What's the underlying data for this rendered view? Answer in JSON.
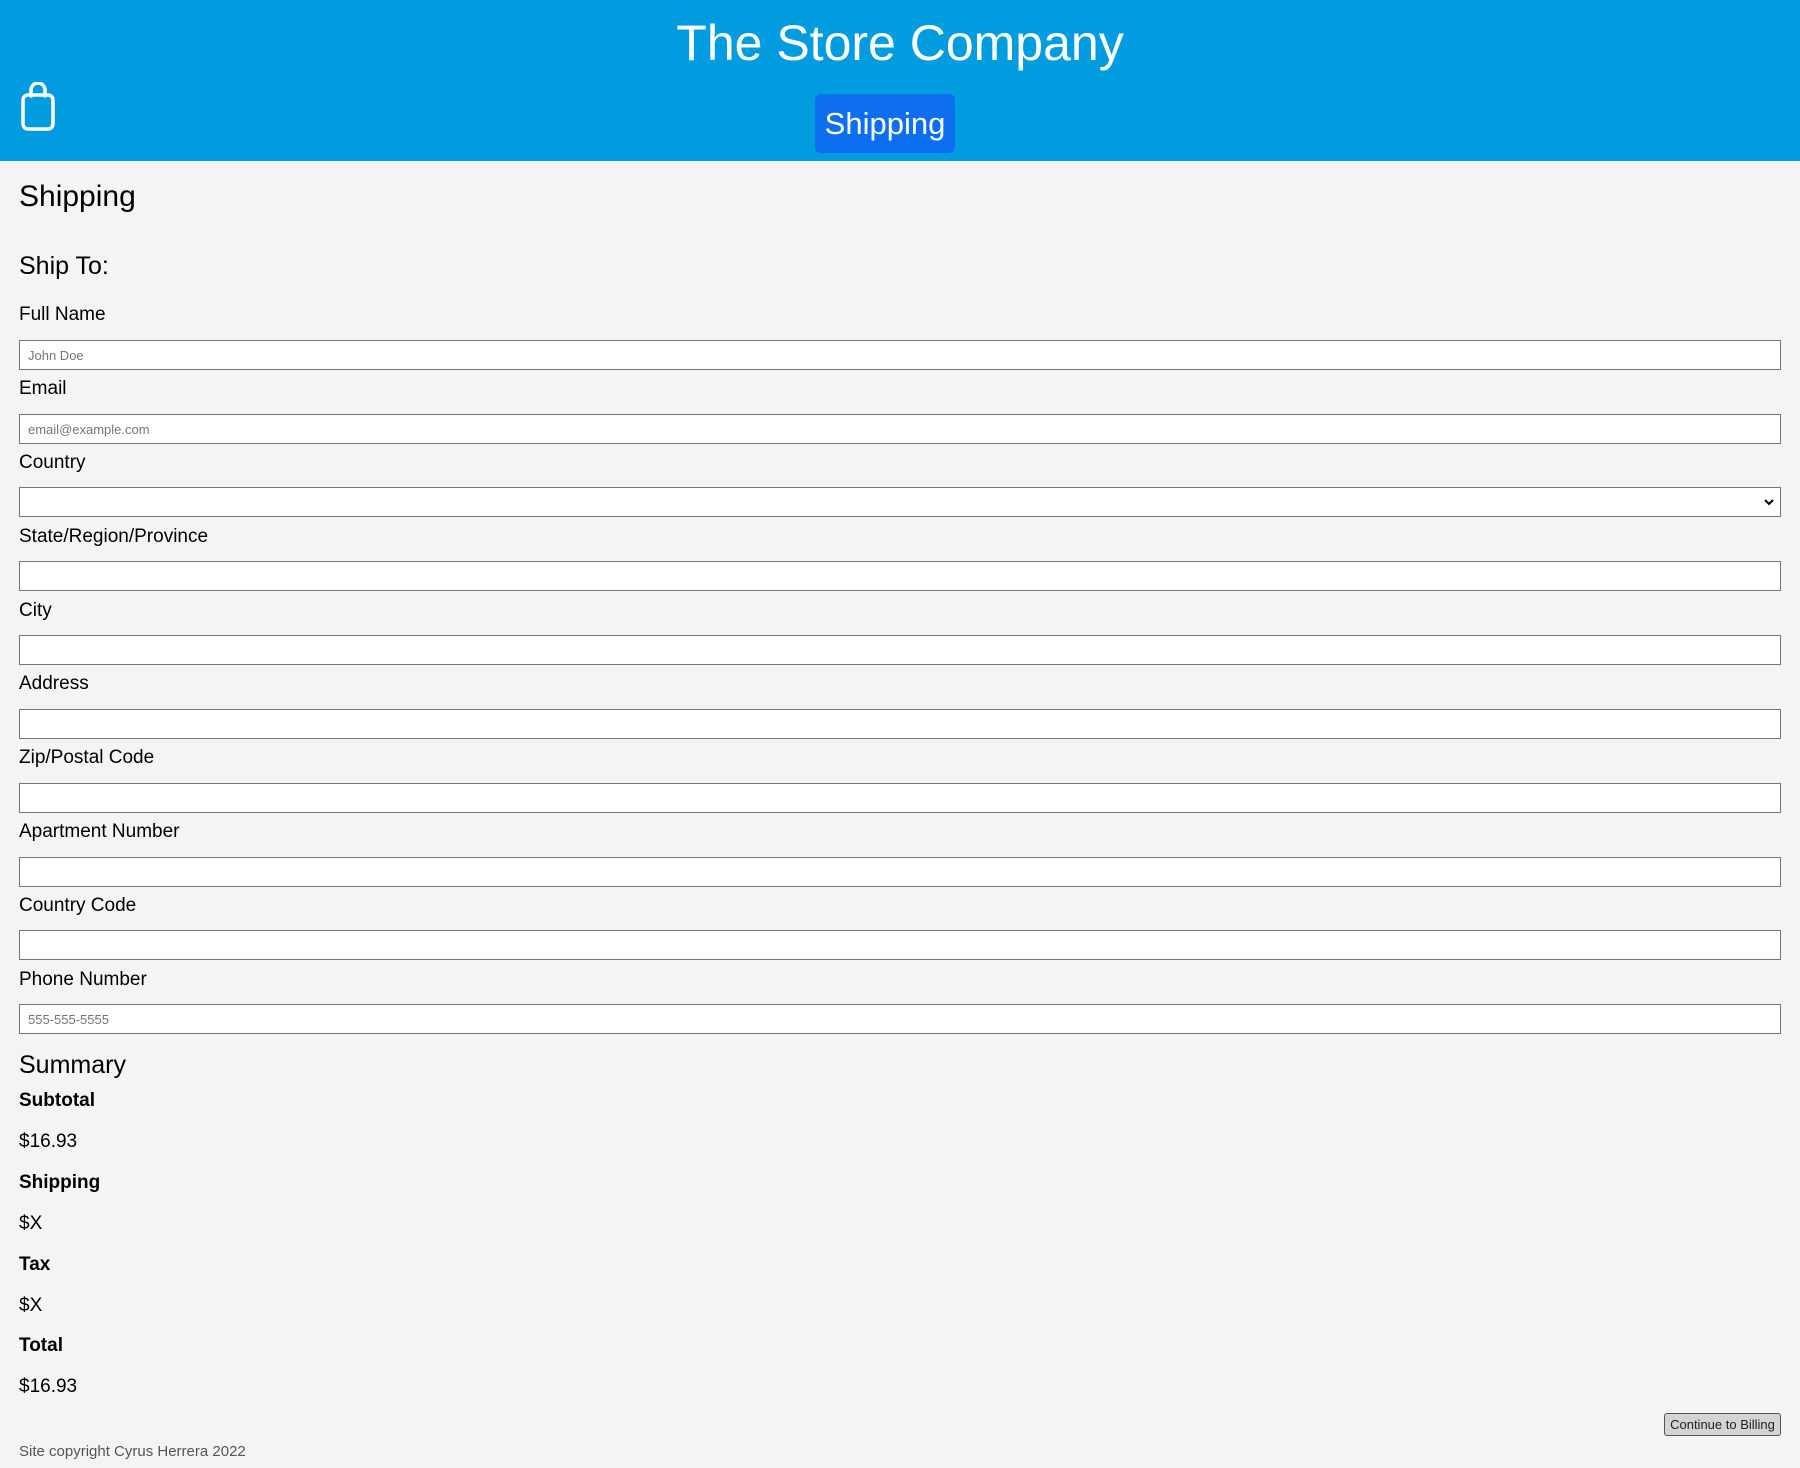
{
  "header": {
    "site_title": "The Store Company",
    "nav_label": "Shipping",
    "cart_icon": "shopping-bag-icon",
    "background_color": "#009ce0",
    "nav_color": "#0d6ff0"
  },
  "page": {
    "title": "Shipping",
    "ship_to_heading": "Ship To:"
  },
  "form": {
    "full_name": {
      "label": "Full Name",
      "placeholder": "John Doe",
      "value": ""
    },
    "email": {
      "label": "Email",
      "placeholder": "email@example.com",
      "value": ""
    },
    "country": {
      "label": "Country",
      "selected": ""
    },
    "state": {
      "label": "State/Region/Province",
      "value": ""
    },
    "city": {
      "label": "City",
      "value": ""
    },
    "address": {
      "label": "Address",
      "value": ""
    },
    "zip": {
      "label": "Zip/Postal Code",
      "value": ""
    },
    "apartment": {
      "label": "Apartment Number",
      "value": ""
    },
    "country_code": {
      "label": "Country Code",
      "value": ""
    },
    "phone": {
      "label": "Phone Number",
      "placeholder": "555-555-5555",
      "value": ""
    }
  },
  "summary": {
    "title": "Summary",
    "subtotal_label": "Subtotal",
    "subtotal_value": "$16.93",
    "shipping_label": "Shipping",
    "shipping_value": "$X",
    "tax_label": "Tax",
    "tax_value": "$X",
    "total_label": "Total",
    "total_value": "$16.93"
  },
  "actions": {
    "continue_label": "Continue to Billing"
  },
  "footer": {
    "copyright": "Site copyright Cyrus Herrera 2022"
  }
}
